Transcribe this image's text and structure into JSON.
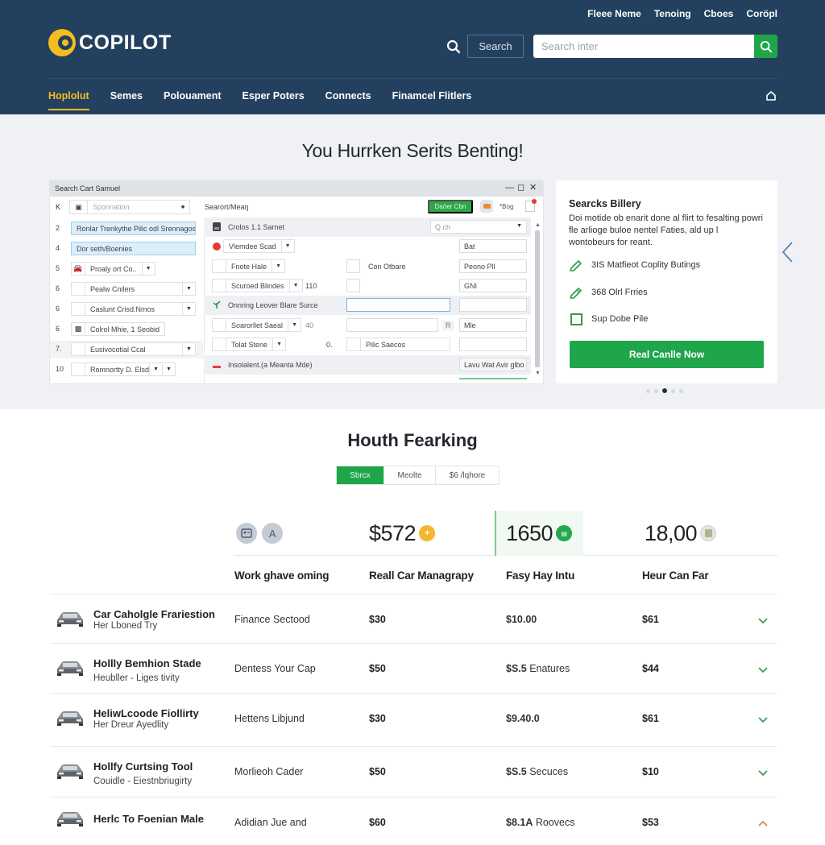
{
  "header": {
    "brand": "COPILOT",
    "top_links": [
      "Fleee Neme",
      "Tenoing",
      "Cboes",
      "Coröpl"
    ],
    "search_button": "Search",
    "search_placeholder": "Search inter",
    "nav": [
      {
        "label": "Hoplolut",
        "active": true
      },
      {
        "label": "Semes",
        "active": false
      },
      {
        "label": "Polouament",
        "active": false
      },
      {
        "label": "Esper Poters",
        "active": false
      },
      {
        "label": "Connects",
        "active": false
      },
      {
        "label": "Finamcel Flitlers",
        "active": false
      }
    ]
  },
  "hero": {
    "title": "You Hurrken Serits Benting!",
    "app_window": {
      "title": "Search Cart Samuel",
      "window_controls": [
        "minimize",
        "maximize",
        "close"
      ],
      "toolbar": {
        "k_label": "K",
        "combo_placeholder": "Sponnation",
        "label": "Searort/Meaŋ",
        "green_button": "Daöer Cbn",
        "flag_text": "*Bog"
      },
      "left_rows": [
        {
          "num": "2",
          "text": "Ronlar Trenkythe Pilic odl Srennagos",
          "highlight": true,
          "dropdown": false,
          "checkbox": false,
          "icon": null
        },
        {
          "num": "4",
          "text": "Dor seth/Boenies",
          "highlight": true,
          "dropdown": false,
          "checkbox": false,
          "icon": null
        },
        {
          "num": "5",
          "text": "Proaly ort Co..",
          "highlight": false,
          "dropdown": true,
          "checkbox": false,
          "icon": "car-icon"
        },
        {
          "num": "6",
          "text": "Pealw Cnilers",
          "highlight": false,
          "dropdown": true,
          "checkbox": true,
          "icon": null
        },
        {
          "num": "6",
          "text": "Caslunt Crisd.Nmos",
          "highlight": false,
          "dropdown": true,
          "checkbox": true,
          "icon": null
        },
        {
          "num": "6",
          "text": "Colrol Mhie, 1 Seobid",
          "highlight": false,
          "dropdown": false,
          "checkbox": false,
          "icon": "badge-icon"
        },
        {
          "num": "7.",
          "text": "Eusivocotial Ccal",
          "highlight": false,
          "dropdown": true,
          "checkbox": true,
          "icon": null,
          "shaded": true
        },
        {
          "num": "10",
          "text": "Romnortty D. Elsdours",
          "highlight": false,
          "dropdown": true,
          "checkbox": true,
          "icon": null
        }
      ],
      "right_rows": [
        {
          "label": "Crolos 1.1 Sarnet",
          "select_placeholder": "Q.ch"
        },
        {
          "label": "Vlemdee Scad",
          "field": "Bat"
        },
        {
          "label": "Fnote Hale",
          "mid_label": "Con Otbare",
          "field": "Peono Pll"
        },
        {
          "label": "Scuroed Blindes",
          "num": "110",
          "field": "GNI"
        },
        {
          "label": "Onnring Leover Blare Surce",
          "field": "",
          "mid_field": ""
        },
        {
          "label": "Soarorllet Saeal",
          "num": "40",
          "tag": "R",
          "field": "Mle"
        },
        {
          "label": "Tolat Stene",
          "num": "0.",
          "mid_label": "Pilic Saecos",
          "field": ""
        },
        {
          "label": "Insolalent.(a Meanta Mde)",
          "button": "Lavu Wat Avir glbo"
        }
      ]
    },
    "promo": {
      "title": "Searcks Billery",
      "body": "Doi motide ob enarit done al flirt to fesalting powri fle arlioge buloe nentel Faties, ald up l wontobeurs for reant.",
      "features": [
        {
          "icon": "pencil-icon",
          "label": "3IS Matfieot Coplity Butings"
        },
        {
          "icon": "pencil-icon",
          "label": "368 Olrl Frries"
        },
        {
          "icon": "checkbox-icon",
          "label": "Sup Dobe Pile"
        }
      ],
      "cta": "Real Canlle Now",
      "carousel": {
        "count": 5,
        "active_index": 2
      }
    }
  },
  "section": {
    "title": "Houth Fearking",
    "segments": [
      {
        "label": "Sbrcx",
        "active": true
      },
      {
        "label": "Meolte",
        "active": false
      },
      {
        "label": "$6 /lqhore",
        "active": false
      }
    ],
    "stats": [
      {
        "value": "$572",
        "icon": "plus-icon",
        "color": "#f5b731"
      },
      {
        "value": "1650",
        "icon": "car-badge-icon",
        "color": "#23a84d",
        "highlight": true
      },
      {
        "value": "18,00",
        "icon": "document-icon",
        "color": "#cfd3cc"
      }
    ],
    "columns": [
      "Work ghave oming",
      "Reall Car Managrapy",
      "Fasy Hay Intu",
      "Heur Can Far"
    ],
    "rows": [
      {
        "name": "Car Caholgle Frariestion",
        "sub": "Her Lboned Try",
        "c1": "Finance Sectood",
        "c2": "$30",
        "c3_bold": "$10.00",
        "c3_rest": "",
        "c4": "$61",
        "chevron": "down"
      },
      {
        "name": "Hollly Bemhion Stade",
        "sub": "Heubller - Liges tivity",
        "c1": "Dentess Your Cap",
        "c2": "$50",
        "c3_bold": "$S.5",
        "c3_rest": " Enatures",
        "c4": "$44",
        "chevron": "down"
      },
      {
        "name": "HeliwLcoode Fiollirty",
        "sub": "Her Dreur Ayedlity",
        "c1": "Hettens Libjund",
        "c2": "$30",
        "c3_bold": "$9.40.0",
        "c3_rest": "",
        "c4": "$61",
        "chevron": "down"
      },
      {
        "name": "Hollfy Curtsing Tool",
        "sub": "Couidle - Eiestnbriugirty",
        "c1": "Morlieoh Cader",
        "c2": "$50",
        "c3_bold": "$S.5",
        "c3_rest": " Secuces",
        "c4": "$10",
        "chevron": "down"
      },
      {
        "name": "Herlc To Foenian Male",
        "sub": "",
        "c1": "Adidian Jue and",
        "c2": "$60",
        "c3_bold": "$8.1A",
        "c3_rest": " Roovecs",
        "c4": "$53",
        "chevron": "up"
      }
    ]
  },
  "colors": {
    "header_bg": "#24405f",
    "accent_yellow": "#f5bd1f",
    "accent_green": "#1fa64a",
    "chevron_down": "#3a9d55",
    "chevron_up": "#d9844a"
  }
}
